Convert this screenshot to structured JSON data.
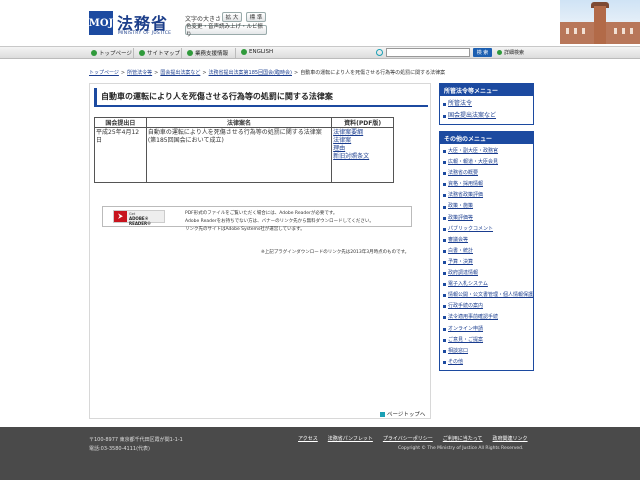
{
  "header": {
    "logo_mark": "MOJ",
    "logo_title": "法務省",
    "logo_subtitle": "MINISTRY OF JUSTICE",
    "font_size_label": "文字の大きさ",
    "font_large": "拡 大",
    "font_standard": "標 準",
    "accessibility_button": "色変更・音声読み上げ・ルビ振り"
  },
  "gnav": {
    "items": [
      "トップページ",
      "サイトマップ",
      "業務支援情報",
      "ENGLISH"
    ],
    "search_placeholder": "",
    "search_button": "検 索",
    "advanced_search": "詳細検索"
  },
  "breadcrumb": {
    "items": [
      "トップページ",
      "所管法令等",
      "国会提出法案など",
      "法務省提出法案第185回国会(臨時会)"
    ],
    "current": "自動車の運転により人を死傷させる行為等の処罰に関する法律案"
  },
  "main": {
    "title": "自動車の運転により人を死傷させる行為等の処罰に関する法律案",
    "table": {
      "headers": [
        "国会提出日",
        "法律案名",
        "資料(PDF版)"
      ],
      "row": {
        "date": "平成25年4月12日",
        "name": "自動車の運転により人を死傷させる行為等の処罰に関する法律案",
        "note": "(第185回国会において成立)",
        "docs": [
          "法律案要綱",
          "法律案",
          "理由",
          "新旧対照条文"
        ]
      }
    },
    "pdf_badge_small": "Get",
    "pdf_badge_name": "ADOBE® READER®",
    "pdf_lines": [
      "PDF形式のファイルをご覧いただく場合には、Adobe Readerが必要です。",
      "Adobe Readerをお持ちでない方は、バナーのリンク先から無料ダウンロードしてください。",
      "リンク先のサイトはAdobe Systems社が運営しています。"
    ],
    "plugin_note": "※上記プラグインダウンロードのリンク先は2013年3月時点のものです。"
  },
  "sidebar": {
    "menu1_title": "所管法令等メニュー",
    "menu1_items": [
      "所管法令",
      "国会提出法案など"
    ],
    "menu2_title": "その他のメニュー",
    "menu2_items": [
      "大臣・副大臣・政務官",
      "広報・報道・大臣会見",
      "法務省の概要",
      "資格・採用情報",
      "法務省政策評価",
      "政策・施策",
      "政策評価等",
      "パブリックコメント",
      "審議会等",
      "白書・統計",
      "予算・決算",
      "政府調達情報",
      "電子入札システム",
      "情報公開・公文書管理・個人情報保護",
      "行政手続の案内",
      "法令適用事前確認手続",
      "オンライン申請",
      "ご意見・ご提案",
      "相談窓口",
      "その他"
    ]
  },
  "page_top": "ページトップへ",
  "footer": {
    "address": "〒100-8977 東京都千代田区霞が関1-1-1",
    "phone": "電話:03-3580-4111(代表)",
    "links": [
      "アクセス",
      "法務省パンフレット",
      "プライバシーポリシー",
      "ご利用に当たって",
      "政府関連リンク"
    ],
    "copyright": "Copyright © The Ministry of Justice All Rights Reserved."
  },
  "colors": {
    "brand_blue": "#1c4aa0",
    "link": "#1a3d8f",
    "footer_bg": "#4a4a4a"
  }
}
